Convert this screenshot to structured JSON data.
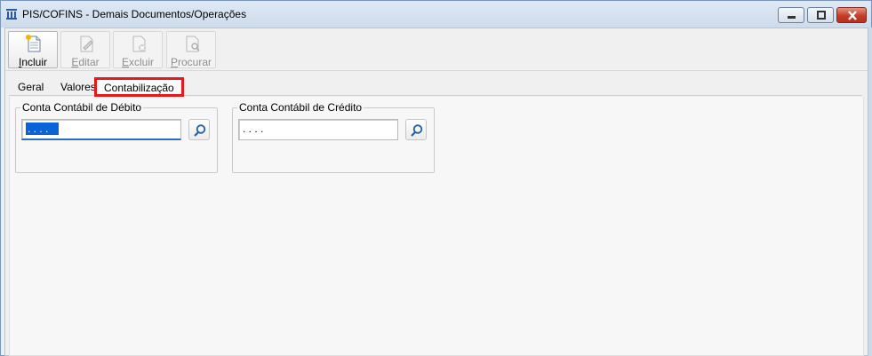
{
  "window": {
    "title": "PIS/COFINS - Demais Documentos/Operações"
  },
  "toolbar": {
    "buttons": [
      {
        "key": "I",
        "rest": "ncluir",
        "icon": "new-document-icon",
        "enabled": true
      },
      {
        "key": "E",
        "rest": "ditar",
        "icon": "edit-document-icon",
        "enabled": false
      },
      {
        "key": "E",
        "rest": "xcluir",
        "icon": "delete-document-icon",
        "enabled": false
      },
      {
        "key": "P",
        "rest": "rocurar",
        "icon": "search-document-icon",
        "enabled": false
      }
    ]
  },
  "tabs": {
    "geral": "Geral",
    "valores": "Valores",
    "contabilizacao": "Contabilização"
  },
  "contabilizacao": {
    "debito": {
      "label": "Conta Contábil de Débito",
      "value": ". . . ."
    },
    "credito": {
      "label": "Conta Contábil de Crédito",
      "value": ". . . ."
    }
  },
  "colors": {
    "highlight_border": "#e3191c",
    "selection": "#0a64d8",
    "titlebar": "#cddbeb"
  }
}
